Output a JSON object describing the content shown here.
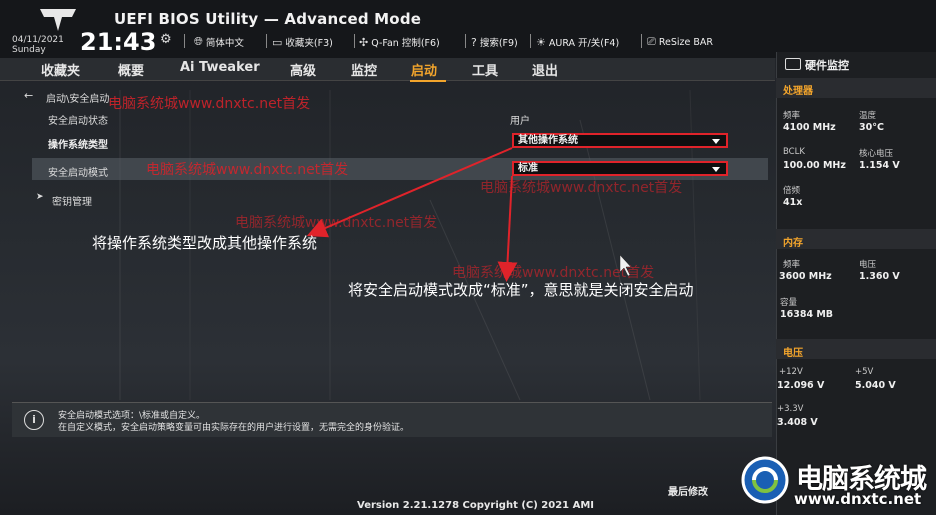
{
  "header": {
    "title": "UEFI BIOS Utility — Advanced Mode",
    "date": "04/11/2021",
    "day": "Sunday",
    "time": "21:43",
    "tools": [
      {
        "icon": "globe-icon",
        "label": "简体中文"
      },
      {
        "icon": "bookmark-icon",
        "label": "收藏夹(F3)"
      },
      {
        "icon": "fan-icon",
        "label": "Q-Fan 控制(F6)"
      },
      {
        "icon": "help-icon",
        "label": "搜索(F9)"
      },
      {
        "icon": "aura-icon",
        "label": "AURA 开/关(F4)"
      },
      {
        "icon": "resize-bar-icon",
        "label": "ReSize BAR"
      }
    ]
  },
  "menu": {
    "tabs": [
      "收藏夹",
      "概要",
      "Ai Tweaker",
      "高级",
      "监控",
      "启动",
      "工具",
      "退出"
    ],
    "active": "启动"
  },
  "content": {
    "breadcrumb": "启动\\安全启动",
    "rows": {
      "secure_boot_state_label": "安全启动状态",
      "secure_boot_state_value": "用户",
      "os_type_label": "操作系统类型",
      "os_type_value": "其他操作系统",
      "secure_boot_mode_label": "安全启动模式",
      "secure_boot_mode_value": "标准",
      "key_management_label": "密钥管理"
    }
  },
  "annotations": {
    "note1": "将操作系统类型改成其他操作系统",
    "note2": "将安全启动模式改成“标准”，意思就是关闭安全启动",
    "watermark": "电脑系统城www.dnxtc.net首发"
  },
  "info": {
    "line1": "安全启动模式选项：\\标准或自定义。",
    "line2": "在自定义模式，安全启动策略变量可由实际存在的用户进行设置，无需完全的身份验证。"
  },
  "footer": {
    "version": "Version 2.21.1278 Copyright (C) 2021 AMI",
    "last_modified": "最后修改"
  },
  "hw_monitor": {
    "title": "硬件监控",
    "cpu": {
      "section": "处理器",
      "freq_label": "频率",
      "freq_value": "4100 MHz",
      "temp_label": "温度",
      "temp_value": "30°C",
      "bclk_label": "BCLK",
      "bclk_value": "100.00 MHz",
      "core_v_label": "核心电压",
      "core_v_value": "1.154 V",
      "ratio_label": "倍频",
      "ratio_value": "41x"
    },
    "memory": {
      "section": "内存",
      "freq_label": "频率",
      "freq_value": "3600 MHz",
      "volt_label": "电压",
      "volt_value": "1.360 V",
      "cap_label": "容量",
      "cap_value": "16384 MB"
    },
    "voltage": {
      "section": "电压",
      "v12_label": "+12V",
      "v12_value": "12.096 V",
      "v5_label": "+5V",
      "v5_value": "5.040 V",
      "v33_label": "+3.3V",
      "v33_value": "3.408 V"
    }
  },
  "brand": {
    "name": "电脑系统城",
    "url": "www.dnxtc.net"
  },
  "colors": {
    "accent": "#f3a52c",
    "annotation_red": "#e0232a"
  }
}
